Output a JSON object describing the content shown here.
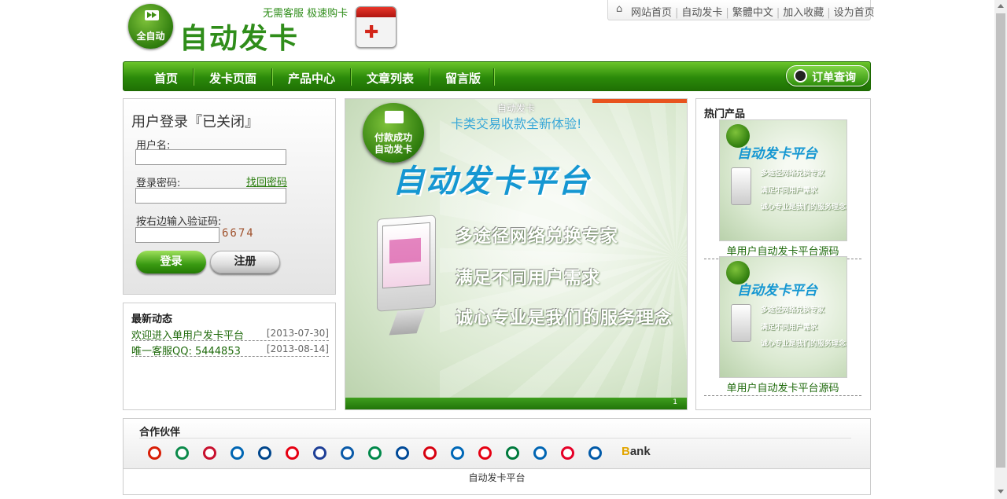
{
  "header": {
    "logo_badge_text": "全自动",
    "logo_title": "自动发卡",
    "slogan": "无需客服  极速购卡",
    "top_links": [
      "网站首页",
      "自动发卡",
      "繁體中文",
      "加入收藏",
      "设为首页"
    ]
  },
  "nav": {
    "items": [
      "首页",
      "发卡页面",
      "产品中心",
      "文章列表",
      "留言版"
    ],
    "order_button": "订单查询"
  },
  "login": {
    "title": "用户登录『已关闭』",
    "username_label": "用户名:",
    "username_value": "",
    "password_label": "登录密码:",
    "password_value": "",
    "forgot_link": "找回密码",
    "captcha_label": "按右边输入验证码:",
    "captcha_value": "",
    "captcha_code": "6674",
    "login_button": "登录",
    "register_button": "注册"
  },
  "news": {
    "title": "最新动态",
    "items": [
      {
        "text": "欢迎进入单用户发卡平台",
        "date": "[2013-07-30]"
      },
      {
        "text": "唯一客服QQ: 5444853",
        "date": "[2013-08-14]"
      }
    ]
  },
  "banner": {
    "caption": "自动发卡",
    "tagline": "卡类交易收款全新体验!",
    "badge_line1": "付款成功",
    "badge_line2": "自动发卡",
    "title": "自动发卡平台",
    "lines": [
      "多途径网络兑换专家",
      "满足不同用户需求",
      "诚心专业是我们的服务理念"
    ],
    "slide_number": "1"
  },
  "hot": {
    "title": "热门产品",
    "products": [
      {
        "caption": "单用户自动发卡平台源码"
      },
      {
        "caption": "单用户自动发卡平台源码"
      }
    ]
  },
  "partners": {
    "title": "合作伙伴",
    "banks": [
      {
        "name": "bank-1",
        "color": "#d81e06"
      },
      {
        "name": "bank-2",
        "color": "#0b8a4a"
      },
      {
        "name": "bank-3",
        "color": "#c8102e"
      },
      {
        "name": "bank-4",
        "color": "#0066b3"
      },
      {
        "name": "bank-5",
        "color": "#00468c"
      },
      {
        "name": "bank-6",
        "color": "#e60012"
      },
      {
        "name": "bank-7",
        "color": "#1e3f97"
      },
      {
        "name": "bank-8",
        "color": "#0a5aa8"
      },
      {
        "name": "bank-9",
        "color": "#00884a"
      },
      {
        "name": "bank-10",
        "color": "#004a98"
      },
      {
        "name": "bank-11",
        "color": "#d7000f"
      },
      {
        "name": "bank-12",
        "color": "#0068b7"
      },
      {
        "name": "bank-13",
        "color": "#e60012"
      },
      {
        "name": "bank-14",
        "color": "#007a3d"
      },
      {
        "name": "bank-15",
        "color": "#0065b3"
      },
      {
        "name": "bank-16",
        "color": "#e60027"
      },
      {
        "name": "bank-17",
        "color": "#0059a8"
      }
    ],
    "bank_text_b": "B",
    "bank_text_rest": "ank"
  },
  "footer": {
    "text": "自动发卡平台"
  }
}
